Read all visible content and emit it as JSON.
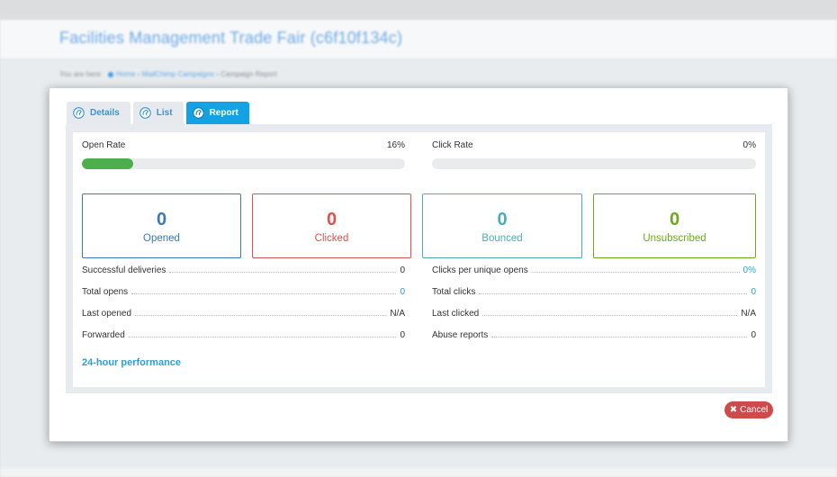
{
  "background": {
    "title": "Facilities Management Trade Fair (c6f10f134c)",
    "breadcrumb": {
      "prefix": "You are here:",
      "home": "Home",
      "sep1": "›",
      "campaigns": "MailChimp Campaigns",
      "sep2": "›",
      "current": "Campaign Report"
    }
  },
  "tabs": [
    {
      "label": "Details",
      "icon": "mailchimp-icon"
    },
    {
      "label": "List",
      "icon": "mailchimp-icon"
    },
    {
      "label": "Report",
      "icon": "mailchimp-icon",
      "active": true
    }
  ],
  "rates": {
    "open": {
      "label": "Open Rate",
      "value": "16%",
      "fraction": 0.16
    },
    "click": {
      "label": "Click Rate",
      "value": "0%",
      "fraction": 0.0
    }
  },
  "stats": {
    "opened": {
      "num": "0",
      "label": "Opened"
    },
    "clicked": {
      "num": "0",
      "label": "Clicked"
    },
    "bounced": {
      "num": "0",
      "label": "Bounced"
    },
    "unsubscribed": {
      "num": "0",
      "label": "Unsubscribed"
    }
  },
  "details_left": [
    {
      "key": "Successful deliveries",
      "value": "0"
    },
    {
      "key": "Total opens",
      "value": "0"
    },
    {
      "key": "Last opened",
      "value": "N/A"
    },
    {
      "key": "Forwarded",
      "value": "0"
    }
  ],
  "details_right": [
    {
      "key": "Clicks per unique opens",
      "value": "0%"
    },
    {
      "key": "Total clicks",
      "value": "0"
    },
    {
      "key": "Last clicked",
      "value": "N/A"
    },
    {
      "key": "Abuse reports",
      "value": "0"
    }
  ],
  "performance_link": "24-hour performance",
  "cancel_label": "Cancel",
  "colors": {
    "tab_active": "#13a2e3",
    "progress": "#4cae4c",
    "opened": "#3a7ab8",
    "clicked": "#d9534f",
    "bounced": "#4aaeb4",
    "unsubscribed": "#6aaa1e",
    "cancel": "#cf4b4b"
  }
}
